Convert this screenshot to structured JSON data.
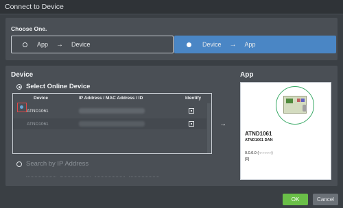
{
  "window": {
    "title": "Connect to Device"
  },
  "choose": {
    "label": "Choose One.",
    "option1": {
      "from": "App",
      "arrow": "→",
      "to": "Device",
      "selected": false
    },
    "option2": {
      "from": "Device",
      "arrow": "→",
      "to": "App",
      "selected": true
    }
  },
  "device": {
    "title": "Device",
    "online_label": "Select Online Device",
    "table": {
      "headers": {
        "device": "Device",
        "ip": "IP Address / MAC Address / ID",
        "identify": "Identify"
      },
      "rows": [
        {
          "device": "ATND1061",
          "selected": true
        },
        {
          "device": "ATND1061",
          "selected": false
        }
      ]
    },
    "search_label": "Search by IP Address"
  },
  "arrow_glyph": "→",
  "app": {
    "title": "App",
    "name": "ATND1061",
    "subtitle": "ATND1061 DAN",
    "version": "0.0.0.0 (-:-:-:-:-:-)",
    "bracket": "[0]"
  },
  "buttons": {
    "ok": "OK",
    "cancel": "Cancel"
  },
  "colors": {
    "accent": "#4a86c5",
    "ok": "#6abf48",
    "selection_highlight": "#e04848"
  }
}
